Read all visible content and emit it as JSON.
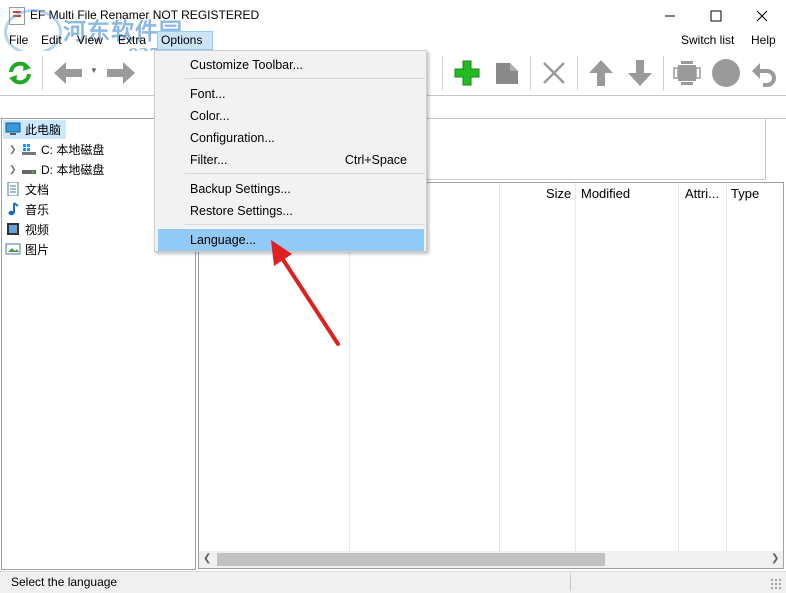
{
  "window": {
    "title": "EF Multi File Renamer NOT REGISTERED",
    "minimize_glyph": "—",
    "maximize_glyph": "☐",
    "close_glyph": "✕"
  },
  "watermark": {
    "text1": "河东软件园",
    "text2": "www.pc0359.cn"
  },
  "menubar": {
    "file": "File",
    "edit": "Edit",
    "view": "View",
    "extra": "Extra",
    "options": "Options",
    "switch_list": "Switch list",
    "help": "Help"
  },
  "toolbar": {
    "icons": [
      "refresh-icon",
      "back-icon",
      "forward-icon",
      "save-icon",
      "add-icon",
      "edit-icon",
      "delete-icon",
      "move-up-icon",
      "move-down-icon",
      "filmstrip-icon",
      "circle-icon",
      "undo-icon"
    ],
    "accent_green": "#22aa22",
    "icon_gray": "#808080"
  },
  "tree": {
    "items": [
      {
        "label": "此电脑",
        "icon": "computer-icon"
      },
      {
        "label": "C: 本地磁盘",
        "icon": "drive-c-icon"
      },
      {
        "label": "D: 本地磁盘",
        "icon": "drive-d-icon"
      },
      {
        "label": "文档",
        "icon": "documents-icon"
      },
      {
        "label": "音乐",
        "icon": "music-icon"
      },
      {
        "label": "视频",
        "icon": "video-icon"
      },
      {
        "label": "图片",
        "icon": "pictures-icon"
      }
    ]
  },
  "list": {
    "columns": [
      "Size",
      "Modified",
      "Attri...",
      "Type"
    ]
  },
  "dropdown": {
    "items": [
      {
        "label": "Customize Toolbar...",
        "shortcut": ""
      },
      {
        "label": "Font...",
        "shortcut": ""
      },
      {
        "label": "Color...",
        "shortcut": ""
      },
      {
        "label": "Configuration...",
        "shortcut": ""
      },
      {
        "label": "Filter...",
        "shortcut": "Ctrl+Space"
      },
      {
        "label": "Backup Settings...",
        "shortcut": ""
      },
      {
        "label": "Restore Settings...",
        "shortcut": ""
      },
      {
        "label": "Language...",
        "shortcut": ""
      }
    ],
    "highlight_color": "#91c9f7"
  },
  "annotation": {
    "arrow_color": "#e02020"
  },
  "status": {
    "text": "Select the language"
  }
}
